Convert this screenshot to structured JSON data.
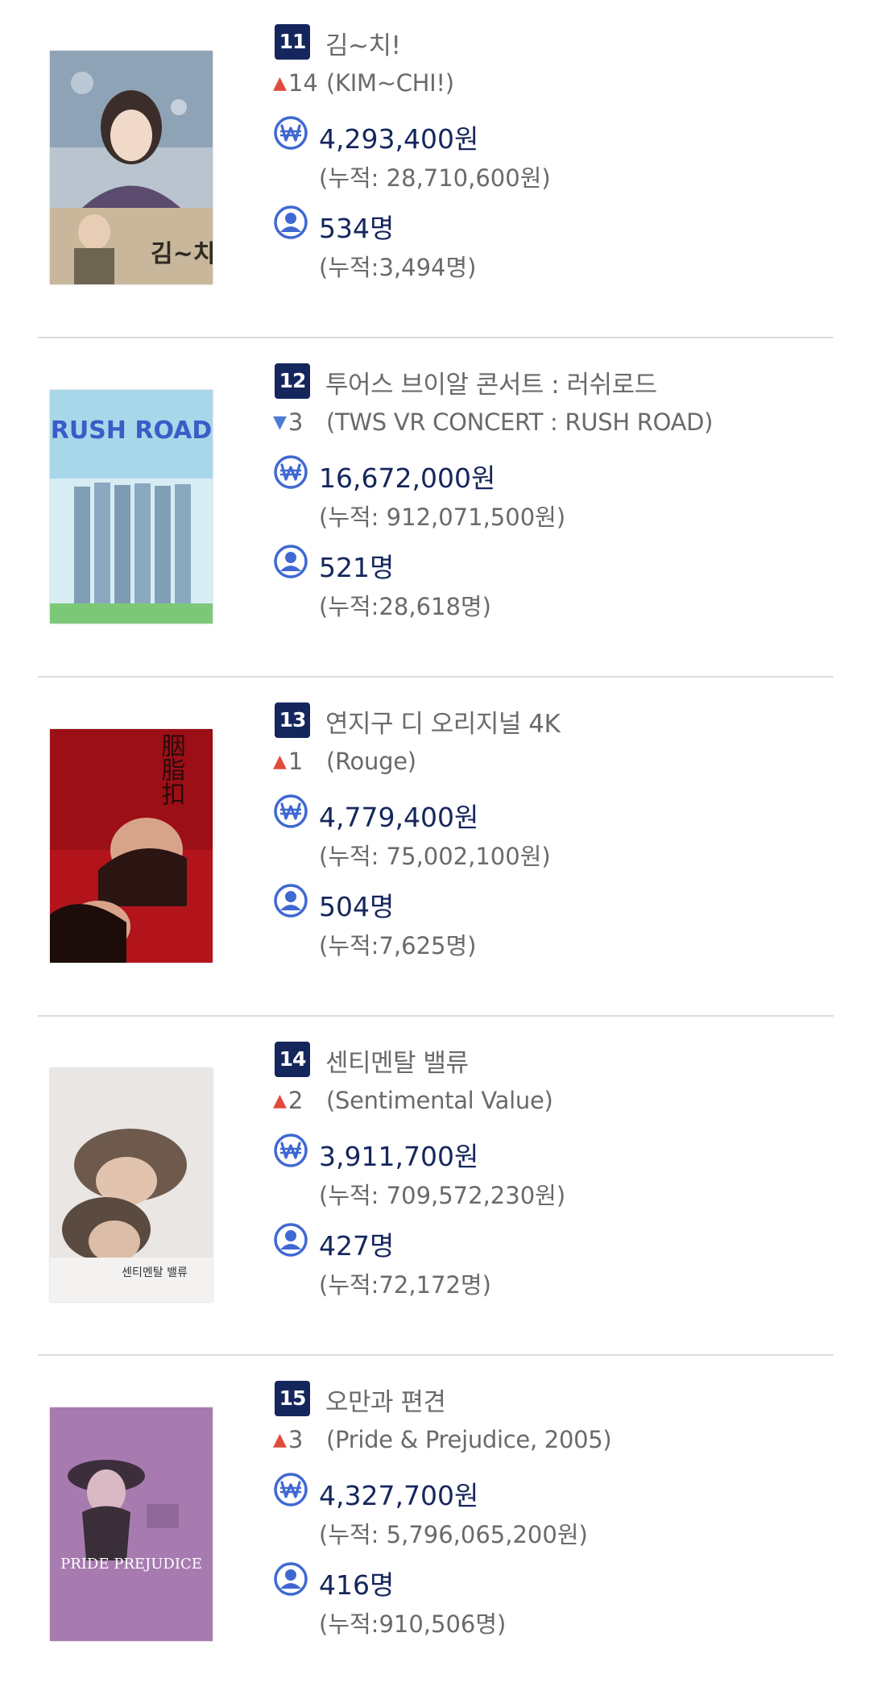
{
  "movies": [
    {
      "rank": "11",
      "title_ko": "김~치!",
      "change_direction": "up",
      "change": "14",
      "title_en": "(KIM~CHI!)",
      "revenue": "4,293,400원",
      "revenue_cumulative": "(누적: 28,710,600원)",
      "audience": "534명",
      "audience_cumulative": "(누적:3,494명)",
      "poster_text": "김~치!"
    },
    {
      "rank": "12",
      "title_ko": "투어스 브이알 콘서트 : 러쉬로드",
      "change_direction": "down",
      "change": "3",
      "title_en": "(TWS VR CONCERT : RUSH ROAD)",
      "revenue": "16,672,000원",
      "revenue_cumulative": "(누적: 912,071,500원)",
      "audience": "521명",
      "audience_cumulative": "(누적:28,618명)",
      "poster_text": "RUSH ROAD"
    },
    {
      "rank": "13",
      "title_ko": "연지구 디 오리지널 4K",
      "change_direction": "up",
      "change": "1",
      "title_en": "(Rouge)",
      "revenue": "4,779,400원",
      "revenue_cumulative": "(누적: 75,002,100원)",
      "audience": "504명",
      "audience_cumulative": "(누적:7,625명)",
      "poster_text": "胭脂扣"
    },
    {
      "rank": "14",
      "title_ko": "센티멘탈 밸류",
      "change_direction": "up",
      "change": "2",
      "title_en": "(Sentimental Value)",
      "revenue": "3,911,700원",
      "revenue_cumulative": "(누적: 709,572,230원)",
      "audience": "427명",
      "audience_cumulative": "(누적:72,172명)",
      "poster_text": "센티멘탈 밸류"
    },
    {
      "rank": "15",
      "title_ko": "오만과 편견",
      "change_direction": "up",
      "change": "3",
      "title_en": "(Pride & Prejudice, 2005)",
      "revenue": "4,327,700원",
      "revenue_cumulative": "(누적: 5,796,065,200원)",
      "audience": "416명",
      "audience_cumulative": "(누적:910,506명)",
      "poster_text": "PRIDE PREJUDICE"
    }
  ],
  "icons": {
    "change_up": "arrow-up-icon",
    "change_down": "arrow-down-icon",
    "revenue": "won-icon",
    "audience": "user-icon"
  },
  "colors": {
    "badge": "#14265c",
    "value": "#14265c",
    "muted": "#6a6a6a",
    "up": "#e04b3c",
    "down": "#4f7bd6",
    "icon": "#3f68d2"
  }
}
